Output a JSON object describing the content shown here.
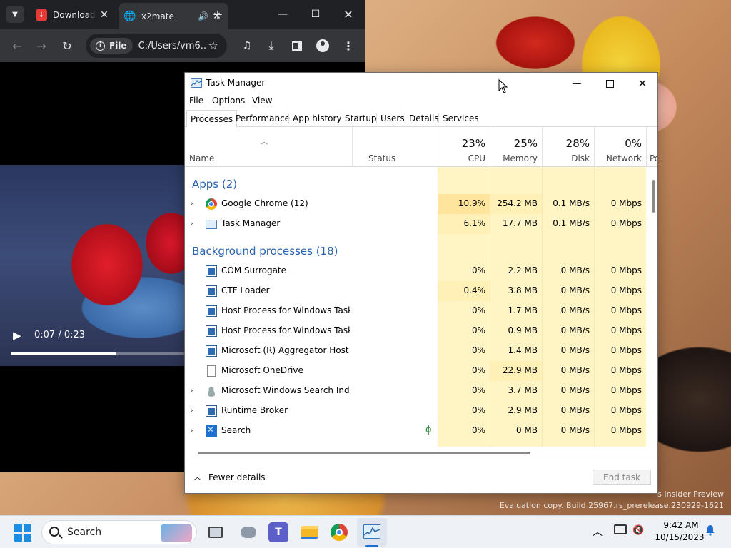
{
  "chrome": {
    "tabs": [
      {
        "title": "Download",
        "close": "✕"
      },
      {
        "title": "x2mate",
        "audio": "🔊",
        "close": "✕"
      }
    ],
    "new_tab": "+",
    "window_controls": {
      "minimize": "—",
      "maximize": "☐",
      "close": "✕"
    },
    "site_chip": "File",
    "url": "C:/Users/vm6...",
    "video": {
      "time": "0:07 / 0:23",
      "progress_fraction": 0.304
    }
  },
  "task_manager": {
    "title": "Task Manager",
    "menu": [
      "File",
      "Options",
      "View"
    ],
    "tabs": [
      "Processes",
      "Performance",
      "App history",
      "Startup",
      "Users",
      "Details",
      "Services"
    ],
    "active_tab": "Processes",
    "columns": {
      "name": "Name",
      "status": "Status",
      "cpu": {
        "pct": "23%",
        "label": "CPU"
      },
      "memory": {
        "pct": "25%",
        "label": "Memory"
      },
      "disk": {
        "pct": "28%",
        "label": "Disk"
      },
      "network": {
        "pct": "0%",
        "label": "Network"
      },
      "power": "Po"
    },
    "groups": {
      "apps": "Apps (2)",
      "background": "Background processes (18)"
    },
    "apps": [
      {
        "name": "Google Chrome (12)",
        "cpu": "10.9%",
        "memory": "254.2 MB",
        "disk": "0.1 MB/s",
        "network": "0 Mbps",
        "icon": "chrome-icon"
      },
      {
        "name": "Task Manager",
        "cpu": "6.1%",
        "memory": "17.7 MB",
        "disk": "0.1 MB/s",
        "network": "0 Mbps",
        "icon": "task-manager-icon"
      }
    ],
    "background": [
      {
        "name": "COM Surrogate",
        "cpu": "0%",
        "memory": "2.2 MB",
        "disk": "0 MB/s",
        "network": "0 Mbps"
      },
      {
        "name": "CTF Loader",
        "cpu": "0.4%",
        "memory": "3.8 MB",
        "disk": "0 MB/s",
        "network": "0 Mbps"
      },
      {
        "name": "Host Process for Windows Tasks",
        "cpu": "0%",
        "memory": "1.7 MB",
        "disk": "0 MB/s",
        "network": "0 Mbps"
      },
      {
        "name": "Host Process for Windows Tasks",
        "cpu": "0%",
        "memory": "0.9 MB",
        "disk": "0 MB/s",
        "network": "0 Mbps"
      },
      {
        "name": "Microsoft (R) Aggregator Host",
        "cpu": "0%",
        "memory": "1.4 MB",
        "disk": "0 MB/s",
        "network": "0 Mbps"
      },
      {
        "name": "Microsoft OneDrive",
        "cpu": "0%",
        "memory": "22.9 MB",
        "disk": "0 MB/s",
        "network": "0 Mbps"
      },
      {
        "name": "Microsoft Windows Search Inde...",
        "cpu": "0%",
        "memory": "3.7 MB",
        "disk": "0 MB/s",
        "network": "0 Mbps"
      },
      {
        "name": "Runtime Broker",
        "cpu": "0%",
        "memory": "2.9 MB",
        "disk": "0 MB/s",
        "network": "0 Mbps"
      },
      {
        "name": "Search",
        "cpu": "0%",
        "memory": "0 MB",
        "disk": "0 MB/s",
        "network": "0 Mbps",
        "status_icon": "ϕ"
      }
    ],
    "footer": {
      "fewer_details": "Fewer details",
      "end_task": "End task"
    }
  },
  "desktop_watermark": {
    "line1": "s Insider Preview",
    "line2": "Evaluation copy. Build 25967.rs_prerelease.230929-1621"
  },
  "taskbar": {
    "search_label": "Search",
    "teams_glyph": "T",
    "time": "9:42 AM",
    "date": "10/15/2023"
  }
}
